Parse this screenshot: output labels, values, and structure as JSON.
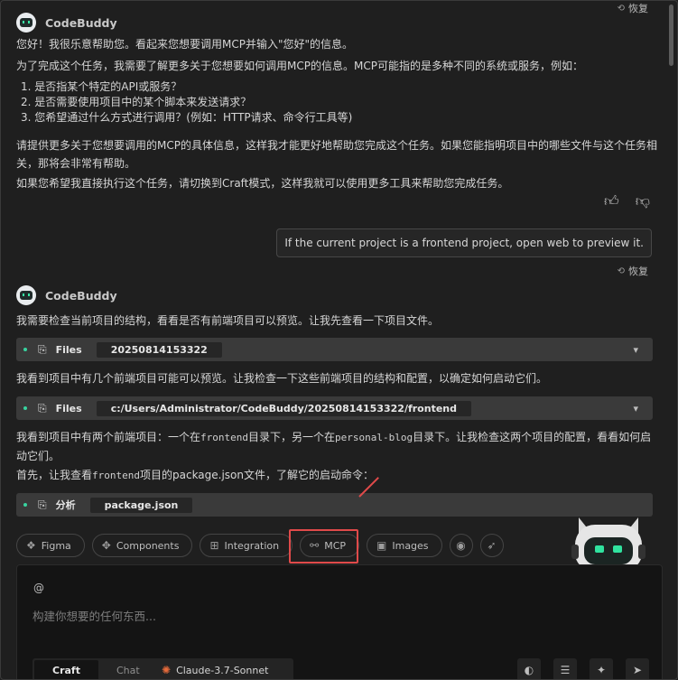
{
  "restore_label": "恢复",
  "assistant_name": "CodeBuddy",
  "message1": {
    "p1": "您好！我很乐意帮助您。看起来您想要调用MCP并输入\"您好\"的信息。",
    "p2": "为了完成这个任务，我需要了解更多关于您想要如何调用MCP的信息。MCP可能指的是多种不同的系统或服务，例如：",
    "list": [
      "1. 是否指某个特定的API或服务？",
      "2. 是否需要使用项目中的某个脚本来发送请求？",
      "3. 您希望通过什么方式进行调用？(例如：HTTP请求、命令行工具等)"
    ],
    "p3": "请提供更多关于您想要调用的MCP的具体信息，这样我才能更好地帮助您完成这个任务。如果您能指明项目中的哪些文件与这个任务相关，那将会非常有帮助。",
    "p4": "如果您希望我直接执行这个任务，请切换到Craft模式，这样我就可以使用更多工具来帮助您完成任务。"
  },
  "user_message": "If the current project is a frontend project, open web to preview it.",
  "message2": {
    "p1": "我需要检查当前项目的结构，看看是否有前端项目可以预览。让我先查看一下项目文件。",
    "file1_label": "Files",
    "file1_value": "20250814153322",
    "p2": "我看到项目中有几个前端项目可能可以预览。让我检查一下这些前端项目的结构和配置，以确定如何启动它们。",
    "file2_label": "Files",
    "file2_value": "c:/Users/Administrator/CodeBuddy/20250814153322/frontend",
    "p3_a": "我看到项目中有两个前端项目：一个在",
    "p3_code1": "frontend",
    "p3_b": "目录下，另一个在",
    "p3_code2": "personal-blog",
    "p3_c": "目录下。让我检查这两个项目的配置，看看如何启动它们。",
    "p4_a": "首先，让我查看",
    "p4_code": "frontend",
    "p4_b": "项目的package.json文件，了解它的启动命令：",
    "file3_label": "分析",
    "file3_value": "package.json"
  },
  "toolbar": {
    "figma": "Figma",
    "components": "Components",
    "integration": "Integration",
    "mcp": "MCP",
    "images": "Images"
  },
  "composer": {
    "at": "@",
    "placeholder": "构建你想要的任何东西...",
    "mode_craft": "Craft",
    "mode_chat": "Chat",
    "model": "Claude-3.7-Sonnet"
  },
  "colors": {
    "accent_green": "#38d39f",
    "highlight_red": "#e04a4a",
    "model_orange": "#e76b3b"
  }
}
